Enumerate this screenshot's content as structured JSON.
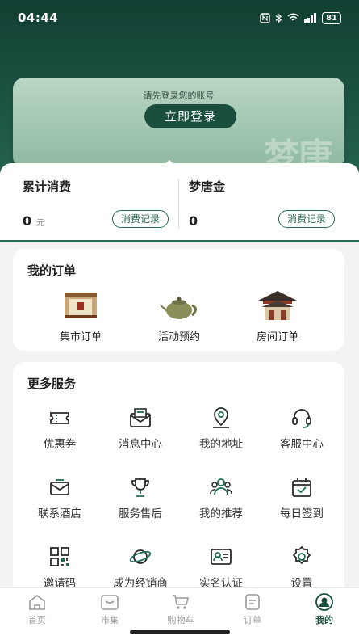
{
  "status_bar": {
    "time": "04:44",
    "icons": [
      "nfc-icon",
      "bluetooth-icon",
      "wifi-icon",
      "signal-icon"
    ],
    "battery": "81"
  },
  "login": {
    "prompt": "请先登录您的账号",
    "button_label": "立即登录",
    "watermark": "梦唐"
  },
  "balances": {
    "consumption": {
      "title": "累计消费",
      "value": "0",
      "unit": "元",
      "record_label": "消费记录"
    },
    "gold": {
      "title": "梦唐金",
      "value": "0",
      "record_label": "消费记录"
    }
  },
  "orders": {
    "title": "我的订单",
    "items": [
      {
        "label": "集市订单",
        "icon": "tea-box-icon"
      },
      {
        "label": "活动预约",
        "icon": "teapot-icon"
      },
      {
        "label": "房间订单",
        "icon": "pavilion-icon"
      }
    ]
  },
  "services": {
    "title": "更多服务",
    "items": [
      {
        "label": "优惠券",
        "icon": "coupon-icon"
      },
      {
        "label": "消息中心",
        "icon": "message-icon"
      },
      {
        "label": "我的地址",
        "icon": "location-icon"
      },
      {
        "label": "客服中心",
        "icon": "headset-icon"
      },
      {
        "label": "联系酒店",
        "icon": "mail-icon"
      },
      {
        "label": "服务售后",
        "icon": "trophy-icon"
      },
      {
        "label": "我的推荐",
        "icon": "users-icon"
      },
      {
        "label": "每日签到",
        "icon": "calendar-check-icon"
      },
      {
        "label": "邀请码",
        "icon": "qr-code-icon"
      },
      {
        "label": "成为经销商",
        "icon": "planet-icon"
      },
      {
        "label": "实名认证",
        "icon": "id-card-icon"
      },
      {
        "label": "设置",
        "icon": "settings-icon"
      }
    ]
  },
  "tab_bar": {
    "items": [
      {
        "label": "首页",
        "icon": "home-icon",
        "active": false
      },
      {
        "label": "市集",
        "icon": "market-icon",
        "active": false
      },
      {
        "label": "购物车",
        "icon": "cart-icon",
        "active": false
      },
      {
        "label": "订单",
        "icon": "order-icon",
        "active": false
      },
      {
        "label": "我的",
        "icon": "profile-icon",
        "active": true
      }
    ]
  },
  "colors": {
    "primary": "#1a4f3f",
    "hero_top": "#123f33",
    "card_bg": "#ffffff",
    "page_bg": "#f2f3f2"
  }
}
